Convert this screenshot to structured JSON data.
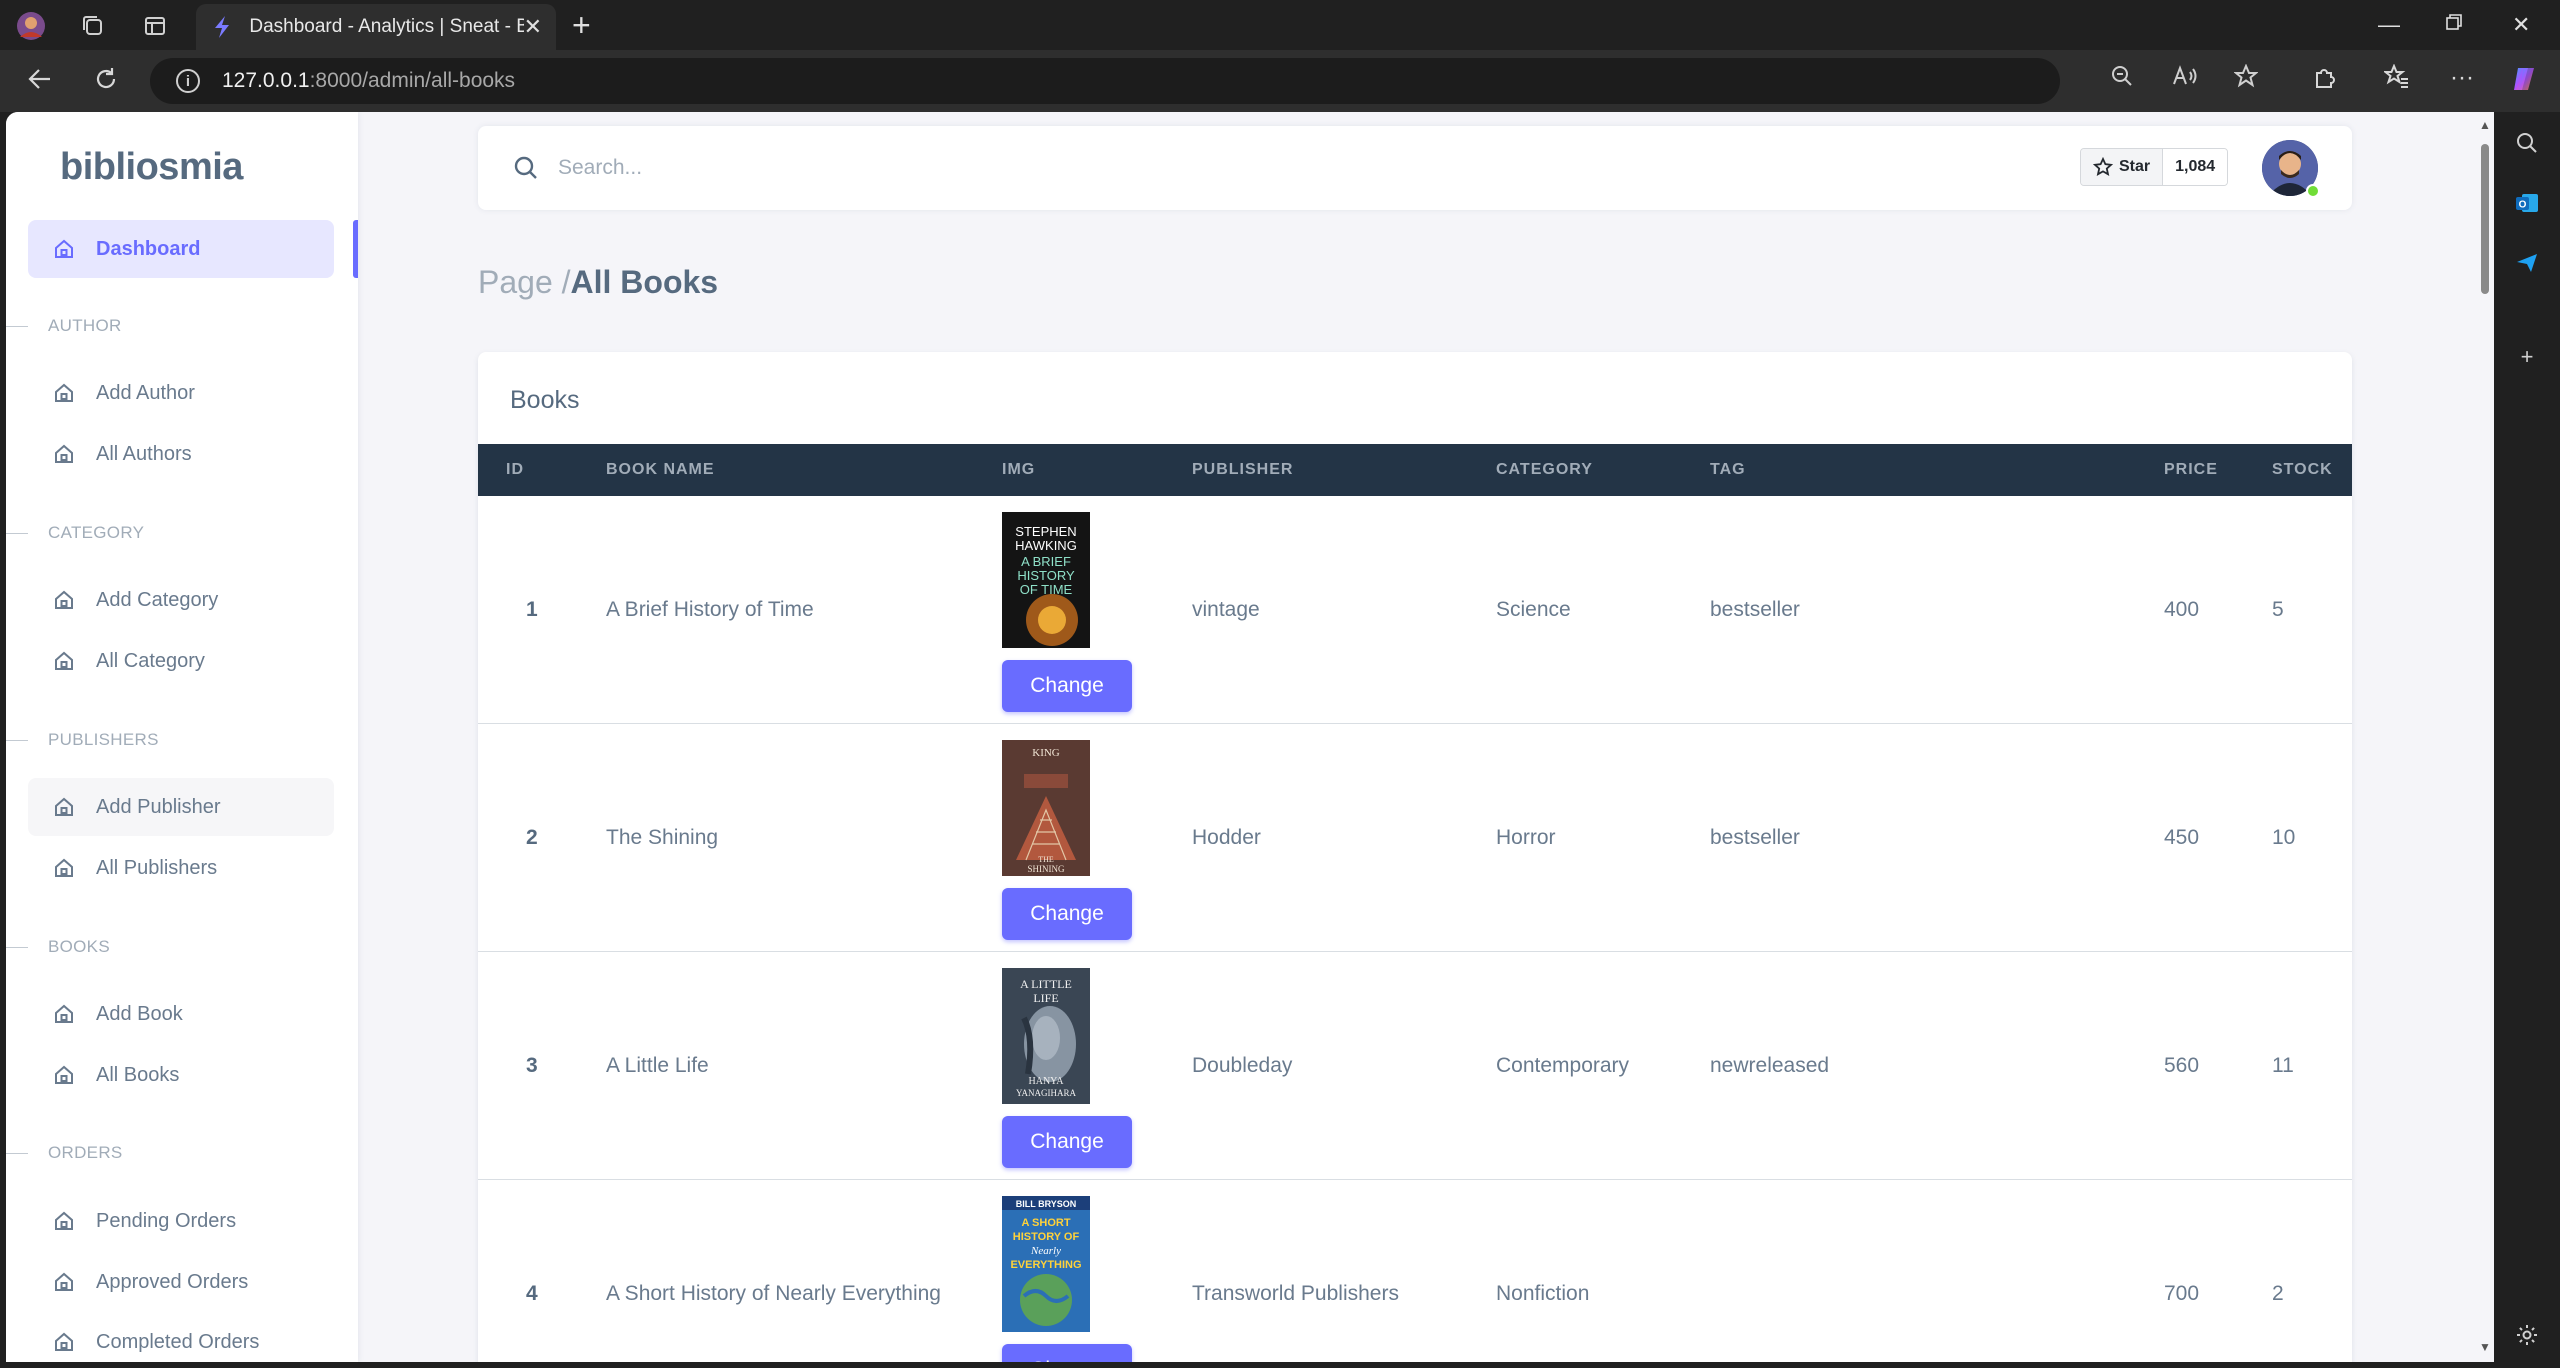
{
  "browser": {
    "tab_title": "Dashboard - Analytics | Sneat - Bo",
    "url_host": "127.0.0.1",
    "url_path": ":8000/admin/all-books"
  },
  "sidebar": {
    "brand": "bibliosmia",
    "dashboard": "Dashboard",
    "sections": {
      "author": "AUTHOR",
      "category": "CATEGORY",
      "publishers": "PUBLISHERS",
      "books": "BOOKS",
      "orders": "ORDERS"
    },
    "items": {
      "add_author": "Add Author",
      "all_authors": "All Authors",
      "add_category": "Add Category",
      "all_category": "All Category",
      "add_publisher": "Add Publisher",
      "all_publishers": "All Publishers",
      "add_book": "Add Book",
      "all_books": "All Books",
      "pending_orders": "Pending Orders",
      "approved_orders": "Approved Orders",
      "completed_orders": "Completed Orders"
    }
  },
  "navbar": {
    "search_placeholder": "Search...",
    "star_label": "Star",
    "star_count": "1,084"
  },
  "breadcrumb": {
    "prefix": "Page /",
    "current": "All Books"
  },
  "table": {
    "title": "Books",
    "headers": {
      "id": "ID",
      "name": "BOOK NAME",
      "img": "IMG",
      "publisher": "PUBLISHER",
      "category": "CATEGORY",
      "tag": "TAG",
      "price": "PRICE",
      "stock": "STOCK"
    },
    "change_label": "Change",
    "rows": [
      {
        "id": "1",
        "name": "A Brief History of Time",
        "publisher": "vintage",
        "category": "Science",
        "tag": "bestseller",
        "price": "400",
        "stock": "5",
        "cover": {
          "l1": "STEPHEN",
          "l2": "HAWKING",
          "l3": "A BRIEF",
          "l4": "HISTORY",
          "l5": "OF TIME"
        }
      },
      {
        "id": "2",
        "name": "The Shining",
        "publisher": "Hodder",
        "category": "Horror",
        "tag": "bestseller",
        "price": "450",
        "stock": "10",
        "cover": {
          "l1": "KING",
          "l2": "THE",
          "l3": "SHINING"
        }
      },
      {
        "id": "3",
        "name": "A Little Life",
        "publisher": "Doubleday",
        "category": "Contemporary",
        "tag": "newreleased",
        "price": "560",
        "stock": "11",
        "cover": {
          "l1": "A LITTLE",
          "l2": "LIFE",
          "l3": "HANYA",
          "l4": "YANAGIHARA"
        }
      },
      {
        "id": "4",
        "name": "A Short History of Nearly Everything",
        "publisher": "Transworld Publishers",
        "category": "Nonfiction",
        "tag": "",
        "price": "700",
        "stock": "2",
        "cover": {
          "l1": "BILL BRYSON",
          "l2": "A SHORT",
          "l3": "HISTORY OF",
          "l4": "Nearly",
          "l5": "EVERYTHING"
        }
      }
    ]
  }
}
